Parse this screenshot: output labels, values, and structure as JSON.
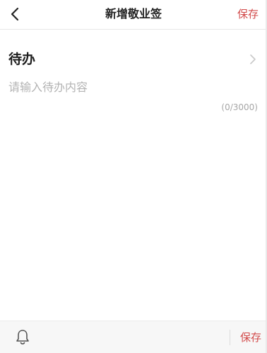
{
  "header": {
    "title": "新增敬业签",
    "save_label": "保存",
    "back_icon": "chevron-left-icon"
  },
  "category": {
    "label": "待办",
    "chevron_icon": "chevron-right-icon"
  },
  "content": {
    "value": "",
    "placeholder": "请输入待办内容",
    "counter": "(0/3000)"
  },
  "footer": {
    "reminder_icon": "bell-icon",
    "save_label": "保存"
  },
  "colors": {
    "accent": "#d24a4a",
    "placeholder": "#b3b3b3",
    "footer_bg": "#f7f7f7"
  }
}
